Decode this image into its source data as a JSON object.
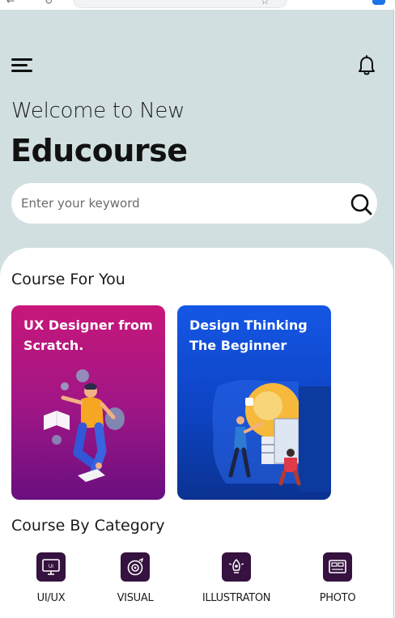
{
  "header": {
    "welcome_line": "Welcome to New",
    "brand_name": "Educourse"
  },
  "search": {
    "placeholder": "Enter your keyword"
  },
  "sections": {
    "for_you": "Course For You",
    "by_category": "Course By Category"
  },
  "courses": [
    {
      "title": "UX Designer from Scratch.",
      "color": "#b81682"
    },
    {
      "title": "Design Thinking The Beginner",
      "color": "#1252dd"
    }
  ],
  "categories": [
    {
      "label": "UI/UX",
      "icon": "ui-ux-icon"
    },
    {
      "label": "VISUAL",
      "icon": "visual-icon"
    },
    {
      "label": "ILLUSTRATON",
      "icon": "illustration-icon"
    },
    {
      "label": "PHOTO",
      "icon": "photo-icon"
    }
  ],
  "colors": {
    "header_bg": "#d1dfe0",
    "category_tile": "#35123f"
  }
}
